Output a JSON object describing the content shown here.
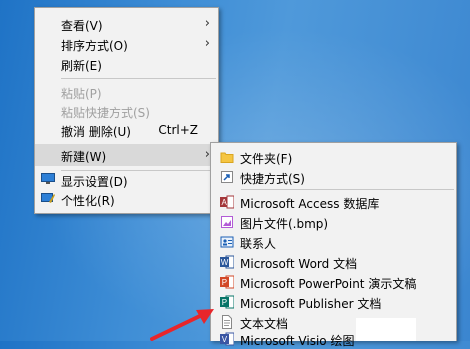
{
  "context_menu": {
    "items": [
      {
        "label": "查看(V)"
      },
      {
        "label": "排序方式(O)"
      },
      {
        "label": "刷新(E)"
      },
      {
        "label": "粘贴(P)"
      },
      {
        "label": "粘贴快捷方式(S)"
      },
      {
        "label": "撤消 删除(U)",
        "shortcut": "Ctrl+Z"
      },
      {
        "label": "新建(W)"
      },
      {
        "label": "显示设置(D)"
      },
      {
        "label": "个性化(R)"
      }
    ],
    "submenu_arrow": "›"
  },
  "new_submenu": {
    "items": [
      {
        "label": "文件夹(F)",
        "icon": "folder-icon"
      },
      {
        "label": "快捷方式(S)",
        "icon": "shortcut-icon"
      },
      {
        "label": "Microsoft Access 数据库",
        "icon": "access-icon"
      },
      {
        "label": "图片文件(.bmp)",
        "icon": "bitmap-icon"
      },
      {
        "label": "联系人",
        "icon": "contact-icon"
      },
      {
        "label": "Microsoft Word 文档",
        "icon": "word-icon"
      },
      {
        "label": "Microsoft PowerPoint 演示文稿",
        "icon": "powerpoint-icon"
      },
      {
        "label": "Microsoft Publisher 文档",
        "icon": "publisher-icon"
      },
      {
        "label": "文本文档",
        "icon": "text-document-icon"
      },
      {
        "label": "Microsoft Visio 绘图",
        "icon": "visio-icon"
      }
    ]
  },
  "colors": {
    "desktop_blue": "#3f8ed6",
    "menu_bg": "#f2f2f2",
    "highlight": "#d9d9d9",
    "arrow_red": "#e8262b"
  }
}
